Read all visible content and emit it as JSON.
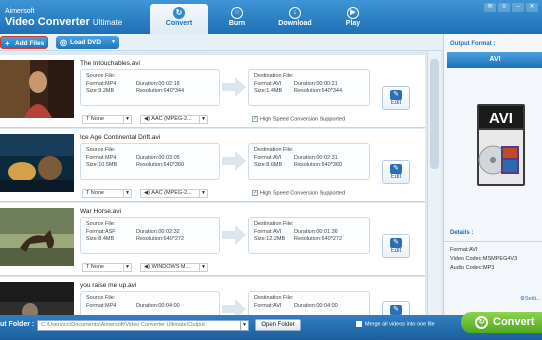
{
  "app": {
    "brand_small": "Aimersoft",
    "brand_big": "Video Converter",
    "brand_suffix": "Ultimate"
  },
  "tabs": [
    {
      "label": "Convert",
      "icon": "refresh-icon",
      "active": true
    },
    {
      "label": "Burn",
      "icon": "disc-icon",
      "active": false
    },
    {
      "label": "Download",
      "icon": "download-icon",
      "active": false
    },
    {
      "label": "Play",
      "icon": "play-icon",
      "active": false
    }
  ],
  "toolbar": {
    "add_files": "Add Files",
    "load_dvd": "Load DVD"
  },
  "labels": {
    "source": "Source File:",
    "destination": "Destination File:",
    "edit": "Edit",
    "high_speed": "High Speed Conversion Supported"
  },
  "files": [
    {
      "name": "The Intouchables.avi",
      "src": {
        "format": "Format:MP4",
        "size": "Size:9.2MB",
        "duration": "Duration:00:02:18",
        "resolution": "Resolution:640*344"
      },
      "dst": {
        "format": "Format:AVI",
        "size": "Size:1.4MB",
        "duration": "Duration:00:00:21",
        "resolution": "Resolution:640*344"
      },
      "subtitle": "None",
      "audio": "AAC (MPEG-2..."
    },
    {
      "name": "Ice Age Continental Drift.avi",
      "src": {
        "format": "Format:MP4",
        "size": "Size:10.5MB",
        "duration": "Duration:00:03:05",
        "resolution": "Resolution:640*360"
      },
      "dst": {
        "format": "Format:AVI",
        "size": "Size:8.6MB",
        "duration": "Duration:00:02:31",
        "resolution": "Resolution:640*360"
      },
      "subtitle": "None",
      "audio": "AAC (MPEG-2..."
    },
    {
      "name": "War Horse.avi",
      "src": {
        "format": "Format:ASF",
        "size": "Size:8.4MB",
        "duration": "Duration:00:02:32",
        "resolution": "Resolution:640*272"
      },
      "dst": {
        "format": "Format:AVI",
        "size": "Size:12.2MB",
        "duration": "Duration:00:01:36",
        "resolution": "Resolution:640*272"
      },
      "subtitle": "None",
      "audio": "WINDOWS M..."
    },
    {
      "name": "you raise me up.avi",
      "src": {
        "format": "Format:MP4",
        "size": "",
        "duration": "Duration:00:04:00",
        "resolution": ""
      },
      "dst": {
        "format": "Format:AVI",
        "size": "",
        "duration": "Duration:00:04:00",
        "resolution": ""
      },
      "subtitle": "None",
      "audio": ""
    }
  ],
  "panel": {
    "output_format_label": "Output Format :",
    "format": "AVI",
    "details_label": "Details :",
    "details": [
      "Format:AVI",
      "Video Codec:MSMPEG4V3",
      "Audio Codec:MP3"
    ],
    "settings": "Setti..."
  },
  "bottom": {
    "output_folder_label": "ut Folder :",
    "path": "C:\\Users\\cn\\Documents\\Aimersoft\\Video Converter Ultimate\\Output",
    "open_folder": "Open Folder",
    "merge": "Merge all videos into one file",
    "convert": "Convert"
  }
}
